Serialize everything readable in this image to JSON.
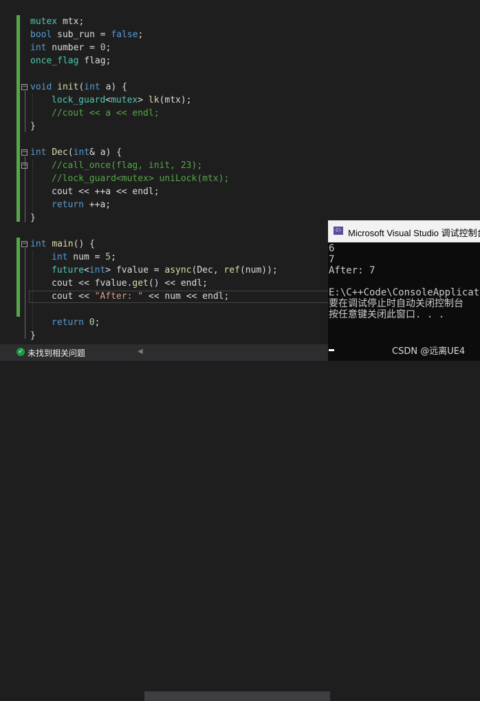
{
  "editor": {
    "lines": {
      "l1": {
        "t1": "mutex",
        "t2": " mtx;"
      },
      "l2": {
        "t1": "bool",
        "t2": " sub_run = ",
        "t3": "false",
        "t4": ";"
      },
      "l3": {
        "t1": "int",
        "t2": " number = ",
        "t3": "0",
        "t4": ";"
      },
      "l4": {
        "t1": "once_flag",
        "t2": " flag;"
      },
      "l6": {
        "t1": "void",
        "t2": " ",
        "t3": "init",
        "t4": "(",
        "t5": "int",
        "t6": " a) {"
      },
      "l7": {
        "t1": "lock_guard",
        "t2": "<",
        "t3": "mutex",
        "t4": "> ",
        "t5": "lk",
        "t6": "(mtx);"
      },
      "l8": {
        "t1": "//cout << a << endl;"
      },
      "l9": {
        "t1": "}"
      },
      "l11": {
        "t1": "int",
        "t2": " ",
        "t3": "Dec",
        "t4": "(",
        "t5": "int",
        "t6": "& a) {"
      },
      "l12": {
        "t1": "//call_once(flag, init, 23);"
      },
      "l13": {
        "t1": "//lock_guard<mutex> uniLock(mtx);"
      },
      "l14": {
        "t1": "cout << ++a << endl;"
      },
      "l15": {
        "t1": "return",
        "t2": " ++a;"
      },
      "l16": {
        "t1": "}"
      },
      "l18": {
        "t1": "int",
        "t2": " ",
        "t3": "main",
        "t4": "() {"
      },
      "l19": {
        "t1": "int",
        "t2": " num = ",
        "t3": "5",
        "t4": ";"
      },
      "l20": {
        "t1": "future",
        "t2": "<",
        "t3": "int",
        "t4": "> fvalue = ",
        "t5": "async",
        "t6": "(Dec, ",
        "t7": "ref",
        "t8": "(num));"
      },
      "l21": {
        "t1": "cout << fvalue.",
        "t2": "get",
        "t3": "() << endl;"
      },
      "l22": {
        "t1": "cout << ",
        "t2": "\"After: \"",
        "t3": " << num << endl;"
      },
      "l24": {
        "t1": "return",
        "t2": " ",
        "t3": "0",
        "t4": ";"
      },
      "l25": {
        "t1": "}"
      }
    },
    "fold_symbol": "⊟"
  },
  "status": {
    "check_icon": "✓",
    "text": "未找到相关问题",
    "arrow": "◀"
  },
  "console": {
    "icon_label": "C:\\",
    "title": "Microsoft Visual Studio 调试控制台",
    "lines": [
      "6",
      "7",
      "After: 7",
      "",
      "E:\\C++Code\\ConsoleApplication",
      "要在调试停止时自动关闭控制台",
      "按任意键关闭此窗口. . ."
    ]
  },
  "watermark": "CSDN @远离UE4",
  "colors": {
    "keyword": "#569cd6",
    "type": "#4ec9b0",
    "function": "#dcdcaa",
    "number": "#b5cea8",
    "comment": "#57a64a",
    "string": "#d69d85",
    "change_bar": "#57a64a"
  }
}
